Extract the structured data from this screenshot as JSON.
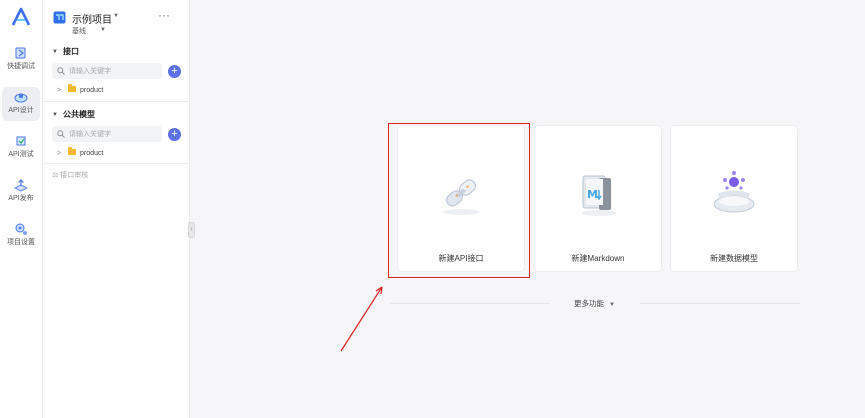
{
  "rail": {
    "items": [
      {
        "label": "快捷调试",
        "icon": "quick-debug-icon"
      },
      {
        "label": "API设计",
        "icon": "api-design-icon",
        "active": true
      },
      {
        "label": "API测试",
        "icon": "api-test-icon"
      },
      {
        "label": "API发布",
        "icon": "api-publish-icon"
      },
      {
        "label": "项目设置",
        "icon": "project-settings-icon"
      }
    ]
  },
  "project": {
    "name": "示例项目",
    "branch": "基线",
    "more": "···"
  },
  "interfaces": {
    "title": "接口",
    "search_placeholder": "请输入关键字",
    "add": "+",
    "tree": [
      {
        "label": "product"
      }
    ]
  },
  "models": {
    "title": "公共模型",
    "search_placeholder": "请输入关键字",
    "add": "+",
    "tree": [
      {
        "label": "product"
      }
    ]
  },
  "review": {
    "label": "接口审核"
  },
  "cards": [
    {
      "label": "新建API接口",
      "icon": "api-link-icon"
    },
    {
      "label": "新建Markdown",
      "icon": "markdown-book-icon"
    },
    {
      "label": "新建数据模型",
      "icon": "data-model-icon"
    }
  ],
  "more": {
    "label": "更多功能"
  },
  "colors": {
    "accent": "#5a72e5",
    "highlight": "#dd2222",
    "folder": "#f5b82e"
  }
}
